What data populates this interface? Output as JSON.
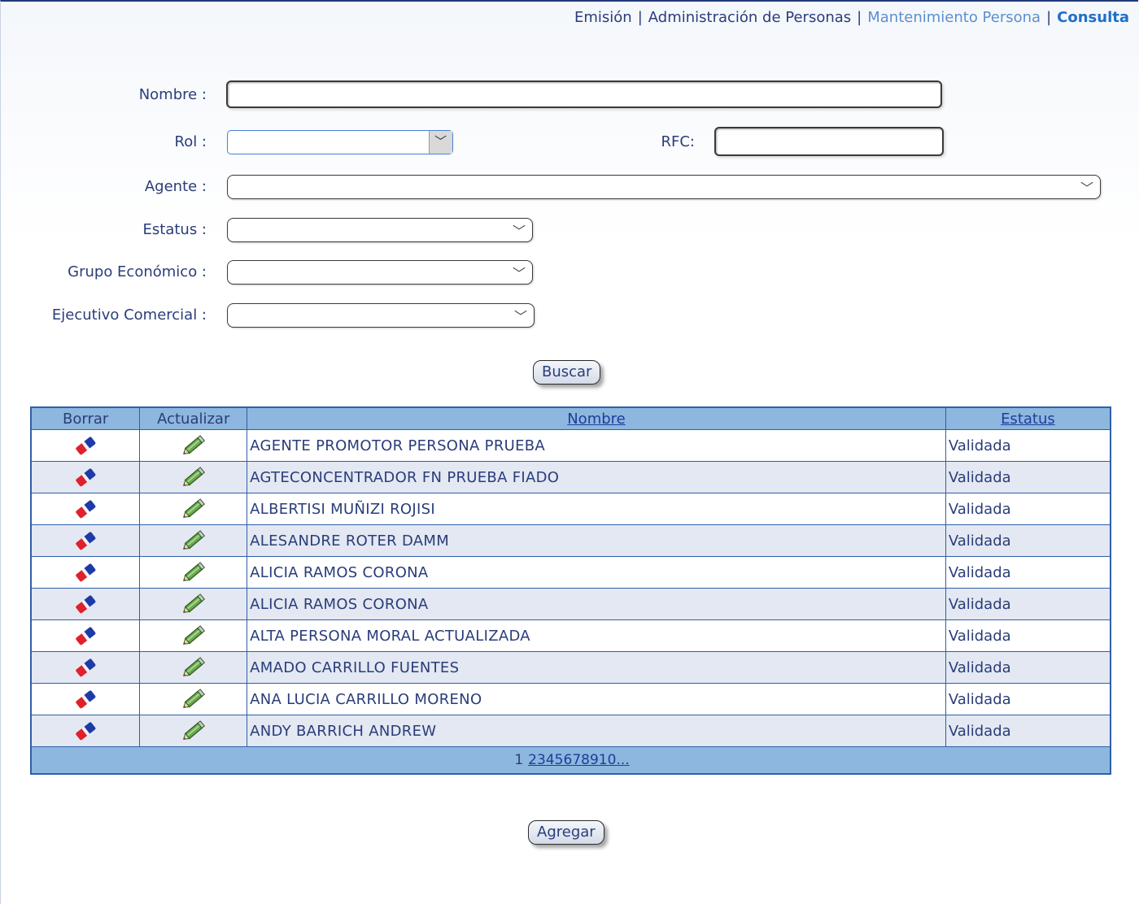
{
  "breadcrumb": {
    "items": [
      {
        "label": "Emisión"
      },
      {
        "label": "Administración de Personas"
      },
      {
        "label": "Mantenimiento Persona"
      },
      {
        "label": "Consulta"
      }
    ],
    "separator": "|"
  },
  "form": {
    "nombre_label": "Nombre :",
    "nombre_value": "",
    "rol_label": "Rol :",
    "rol_value": "",
    "rfc_label": "RFC:",
    "rfc_value": "",
    "agente_label": "Agente :",
    "agente_value": "",
    "estatus_label": "Estatus :",
    "estatus_value": "",
    "grupo_label": "Grupo Económico :",
    "grupo_value": "",
    "ejecutivo_label": "Ejecutivo Comercial :",
    "ejecutivo_value": "",
    "buscar_label": "Buscar"
  },
  "table": {
    "headers": {
      "borrar": "Borrar",
      "actualizar": "Actualizar",
      "nombre": "Nombre",
      "estatus": "Estatus"
    },
    "rows": [
      {
        "nombre": "AGENTE PROMOTOR PERSONA PRUEBA",
        "estatus": "Validada"
      },
      {
        "nombre": "AGTECONCENTRADOR FN PRUEBA FIADO",
        "estatus": "Validada"
      },
      {
        "nombre": "ALBERTISI MUÑIZI ROJISI",
        "estatus": "Validada"
      },
      {
        "nombre": "ALESANDRE ROTER DAMM",
        "estatus": "Validada"
      },
      {
        "nombre": "ALICIA RAMOS CORONA",
        "estatus": "Validada"
      },
      {
        "nombre": "ALICIA RAMOS CORONA",
        "estatus": "Validada"
      },
      {
        "nombre": "ALTA PERSONA MORAL ACTUALIZADA",
        "estatus": "Validada"
      },
      {
        "nombre": "AMADO CARRILLO FUENTES",
        "estatus": "Validada"
      },
      {
        "nombre": "ANA LUCIA CARRILLO MORENO",
        "estatus": "Validada"
      },
      {
        "nombre": "ANDY BARRICH ANDREW",
        "estatus": "Validada"
      }
    ],
    "pager": {
      "current": "1",
      "pages": [
        "2",
        "3",
        "4",
        "5",
        "6",
        "7",
        "8",
        "9",
        "10",
        "..."
      ]
    }
  },
  "agregar_label": "Agregar",
  "icons": {
    "delete": "eraser-icon",
    "update": "pencil-icon"
  },
  "colors": {
    "header_bg": "#8db7de",
    "row_alt": "#e3e8f2",
    "border": "#2f5fa8",
    "text": "#2a3d7a"
  }
}
